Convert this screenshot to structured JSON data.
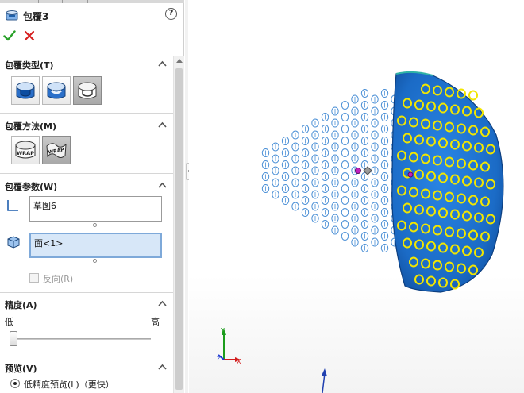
{
  "header": {
    "title": "包覆3",
    "help_label": "?",
    "ok_icon": "check-icon",
    "cancel_icon": "close-icon",
    "accent_ok": "#2aa12a",
    "accent_cancel": "#d62020"
  },
  "sections": {
    "wrap_type": {
      "heading": "包覆类型(T)",
      "options": [
        "emboss-wrap-icon",
        "deboss-wrap-icon",
        "scribe-wrap-icon"
      ],
      "active_index": 2
    },
    "wrap_method": {
      "heading": "包覆方法(M)",
      "options": [
        "wrap-analytical-icon",
        "wrap-spline-icon"
      ],
      "active_index": 1
    },
    "wrap_params": {
      "heading": "包覆参数(W)",
      "sketch_value": "草图6",
      "face_value": "面<1>",
      "reverse_label": "反向(R)",
      "reverse_checked": false
    },
    "accuracy": {
      "heading": "精度(A)",
      "low_label": "低",
      "high_label": "高",
      "level_fraction": 0.0
    },
    "preview": {
      "heading": "预览(V)",
      "low_accuracy_label": "低精度预览(L)（更快）",
      "selected": true
    }
  },
  "viewport": {
    "surface_color": "#1e73d1",
    "wrapped_circle_color": "#f2e600",
    "sketch_circle_color": "#4a8fd6",
    "triad_axes": [
      "Y",
      "X",
      "Z"
    ]
  }
}
